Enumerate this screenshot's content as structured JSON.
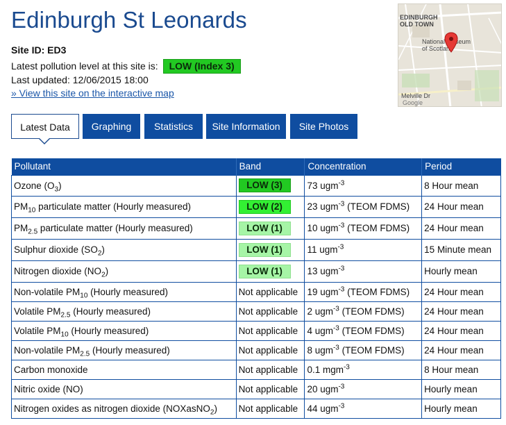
{
  "site": {
    "name": "Edinburgh St Leonards",
    "site_id_label": "Site ID:",
    "site_id": "ED3",
    "level_label": "Latest pollution level at this site is:",
    "level_value": "LOW (Index 3)",
    "updated_label": "Last updated:",
    "updated_value": "12/06/2015 18:00",
    "map_link": "» View this site on the interactive map"
  },
  "map": {
    "labels": [
      "EDINBURGH",
      "OLD TOWN",
      "National Museum",
      "of Scotland",
      "Melville Dr",
      "Google"
    ],
    "pin_color": "#e53935"
  },
  "tabs": [
    {
      "label": "Latest Data",
      "active": true
    },
    {
      "label": "Graphing",
      "active": false
    },
    {
      "label": "Statistics",
      "active": false
    },
    {
      "label": "Site Information",
      "active": false
    },
    {
      "label": "Site Photos",
      "active": false
    }
  ],
  "table": {
    "headers": [
      "Pollutant",
      "Band",
      "Concentration",
      "Period"
    ],
    "rows": [
      {
        "pollutant": [
          "Ozone (O",
          {
            "sub": "3"
          },
          ")"
        ],
        "band": "LOW (3)",
        "band_level": 3,
        "conc": [
          "73 ugm",
          {
            "sup": "-3"
          }
        ],
        "period": "8 Hour mean"
      },
      {
        "pollutant": [
          "PM",
          {
            "sub": "10"
          },
          " particulate matter (Hourly measured)"
        ],
        "band": "LOW (2)",
        "band_level": 2,
        "conc": [
          "23 ugm",
          {
            "sup": "-3"
          },
          " (TEOM FDMS)"
        ],
        "period": "24 Hour mean"
      },
      {
        "pollutant": [
          "PM",
          {
            "sub": "2.5"
          },
          " particulate matter (Hourly measured)"
        ],
        "band": "LOW (1)",
        "band_level": 1,
        "conc": [
          "10 ugm",
          {
            "sup": "-3"
          },
          " (TEOM FDMS)"
        ],
        "period": "24 Hour mean"
      },
      {
        "pollutant": [
          "Sulphur dioxide (SO",
          {
            "sub": "2"
          },
          ")"
        ],
        "band": "LOW (1)",
        "band_level": 1,
        "conc": [
          "11 ugm",
          {
            "sup": "-3"
          }
        ],
        "period": "15 Minute mean"
      },
      {
        "pollutant": [
          "Nitrogen dioxide (NO",
          {
            "sub": "2"
          },
          ")"
        ],
        "band": "LOW (1)",
        "band_level": 1,
        "conc": [
          "13 ugm",
          {
            "sup": "-3"
          }
        ],
        "period": "Hourly mean"
      },
      {
        "pollutant": [
          "Non-volatile PM",
          {
            "sub": "10"
          },
          " (Hourly measured)"
        ],
        "band": "Not applicable",
        "band_level": 0,
        "conc": [
          "19 ugm",
          {
            "sup": "-3"
          },
          " (TEOM FDMS)"
        ],
        "period": "24 Hour mean"
      },
      {
        "pollutant": [
          "Volatile PM",
          {
            "sub": "2.5"
          },
          " (Hourly measured)"
        ],
        "band": "Not applicable",
        "band_level": 0,
        "conc": [
          "2 ugm",
          {
            "sup": "-3"
          },
          " (TEOM FDMS)"
        ],
        "period": "24 Hour mean"
      },
      {
        "pollutant": [
          "Volatile PM",
          {
            "sub": "10"
          },
          " (Hourly measured)"
        ],
        "band": "Not applicable",
        "band_level": 0,
        "conc": [
          "4 ugm",
          {
            "sup": "-3"
          },
          " (TEOM FDMS)"
        ],
        "period": "24 Hour mean"
      },
      {
        "pollutant": [
          "Non-volatile PM",
          {
            "sub": "2.5"
          },
          " (Hourly measured)"
        ],
        "band": "Not applicable",
        "band_level": 0,
        "conc": [
          "8 ugm",
          {
            "sup": "-3"
          },
          " (TEOM FDMS)"
        ],
        "period": "24 Hour mean"
      },
      {
        "pollutant": [
          "Carbon monoxide"
        ],
        "band": "Not applicable",
        "band_level": 0,
        "conc": [
          "0.1 mgm",
          {
            "sup": "-3"
          }
        ],
        "period": "8 Hour mean"
      },
      {
        "pollutant": [
          "Nitric oxide (NO)"
        ],
        "band": "Not applicable",
        "band_level": 0,
        "conc": [
          "20 ugm",
          {
            "sup": "-3"
          }
        ],
        "period": "Hourly mean"
      },
      {
        "pollutant": [
          "Nitrogen oxides as nitrogen dioxide (NOXasNO",
          {
            "sub": "2"
          },
          ")"
        ],
        "band": "Not applicable",
        "band_level": 0,
        "conc": [
          "44 ugm",
          {
            "sup": "-3"
          }
        ],
        "period": "Hourly mean"
      }
    ]
  },
  "colors": {
    "title": "#1a4a8f",
    "tab_bg": "#0f4da0",
    "band_low_3": "#22c922",
    "band_low_2": "#33f033",
    "band_low_1": "#a6f5a6"
  }
}
